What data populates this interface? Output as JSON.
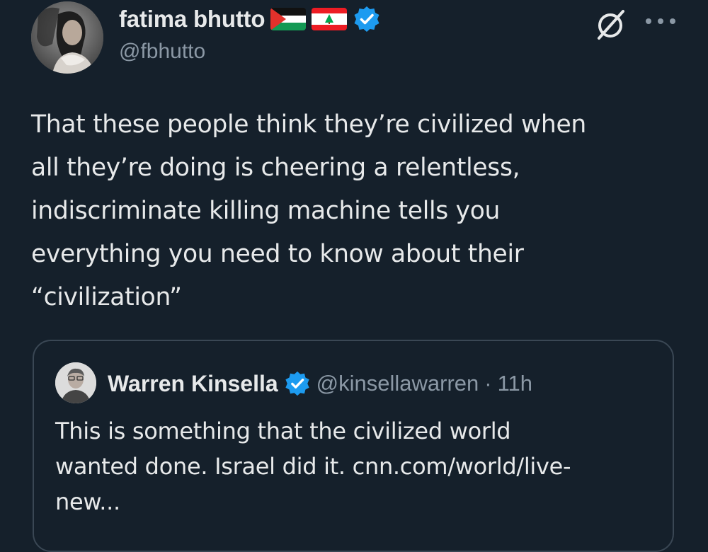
{
  "author": {
    "display_name": "fatima bhutto",
    "handle": "@fbhutto",
    "flags": [
      "palestine-flag",
      "lebanon-flag"
    ],
    "verified": true
  },
  "header_actions": {
    "grok_icon": "grok-slash-icon",
    "more_icon": "more-dots-icon"
  },
  "tweet": {
    "text": "That these people think they’re civilized when\nall they’re doing is cheering a relentless,\nindiscriminate killing machine tells you\neverything you need to know about their\n“civilization”"
  },
  "quoted_tweet": {
    "display_name": "Warren Kinsella",
    "handle": "@kinsellawarren",
    "separator": "·",
    "time": "11h",
    "verified": true,
    "text": "This is something that the civilized world\nwanted done. Israel did it. cnn.com/world/live-\nnew..."
  },
  "colors": {
    "background": "#15202b",
    "text_primary": "#e7e9ea",
    "text_secondary": "#8b98a5",
    "verified_blue": "#1d9bf0",
    "card_border": "#3a4754"
  }
}
